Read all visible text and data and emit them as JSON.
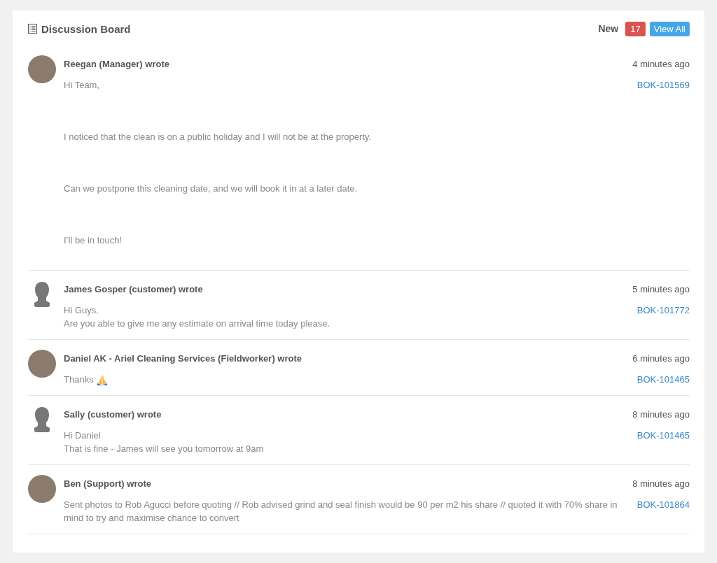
{
  "panel": {
    "title": "Discussion Board",
    "new_label": "New",
    "new_count": "17",
    "view_all": "View All"
  },
  "posts": [
    {
      "author": "Reegan (Manager) wrote",
      "avatar": {
        "kind": "photo"
      },
      "time": "4 minutes ago",
      "ref": "BOK-101569",
      "paragraph_gap": true,
      "lines": [
        "Hi Team,",
        "I noticed that the clean is on a public holiday and I will not be at the property.",
        "Can we postpone this cleaning date, and we will book it in at a later date.",
        "I’ll be in touch!"
      ]
    },
    {
      "author": "James Gosper (customer) wrote",
      "avatar": {
        "kind": "silhouette"
      },
      "time": "5 minutes ago",
      "ref": "BOK-101772",
      "paragraph_gap": false,
      "lines": [
        "Hi Guys.",
        "Are you able to give me any estimate on arrival time today please."
      ]
    },
    {
      "author": "Daniel AK - Ariel Cleaning Services (Fieldworker) wrote",
      "avatar": {
        "kind": "photo"
      },
      "time": "6 minutes ago",
      "ref": "BOK-101465",
      "paragraph_gap": false,
      "lines": [
        "Thanks"
      ],
      "emoji": {
        "kind": "praying-hands"
      }
    },
    {
      "author": "Sally (customer) wrote",
      "avatar": {
        "kind": "silhouette"
      },
      "time": "8 minutes ago",
      "ref": "BOK-101465",
      "paragraph_gap": false,
      "lines": [
        "Hi Daniel",
        "That is fine - James will see you tomorrow at 9am"
      ]
    },
    {
      "author": "Ben (Support) wrote",
      "avatar": {
        "kind": "photo"
      },
      "time": "8 minutes ago",
      "ref": "BOK-101864",
      "paragraph_gap": false,
      "lines": [
        "Sent photos to Rob Agucci before quoting // Rob advised grind and seal finish would be 90 per m2 his share // quoted it with 70% share in mind to try and maximise chance to convert"
      ]
    }
  ]
}
